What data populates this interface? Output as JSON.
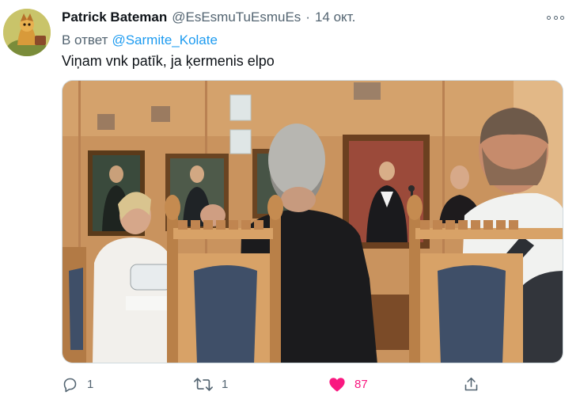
{
  "tweet": {
    "author_name": "Patrick Bateman",
    "author_handle": "@EsEsmuTuEsmuEs",
    "separator": "·",
    "date": "14 окт.",
    "reply_prefix": "В ответ",
    "reply_to": "@Sarmite_Kolate",
    "text": "Viņam vnk patīk, ja ķermenis elpo"
  },
  "actions": {
    "reply_count": "1",
    "retweet_count": "1",
    "like_count": "87"
  },
  "colors": {
    "accent": "#1d9bf0",
    "like": "#f91880",
    "secondary_text": "#536471",
    "primary_text": "#0f1419"
  },
  "icons": {
    "reply": "reply-icon",
    "retweet": "retweet-icon",
    "like": "heart-icon",
    "share": "share-icon",
    "more": "more-icon"
  }
}
